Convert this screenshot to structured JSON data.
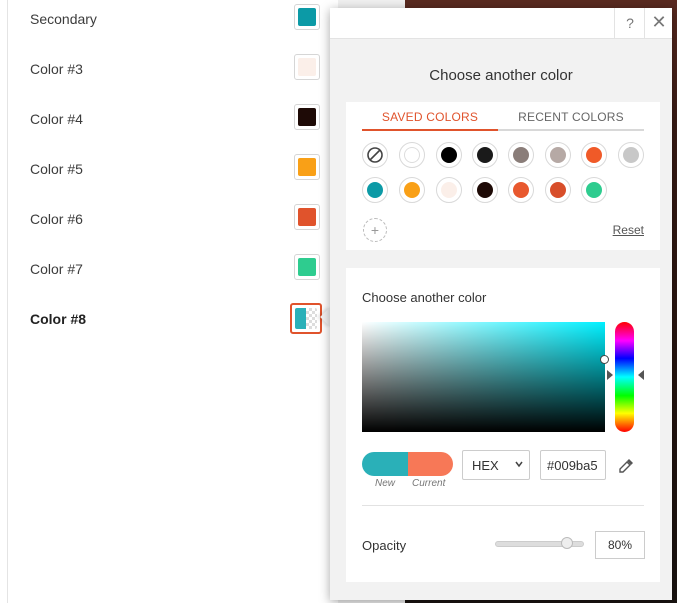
{
  "color_list": {
    "items": [
      {
        "label": "Secondary",
        "color": "#0c9aa6"
      },
      {
        "label": "Color #3",
        "color": "#fbefe9"
      },
      {
        "label": "Color #4",
        "color": "#1e0a06"
      },
      {
        "label": "Color #5",
        "color": "#f9a017"
      },
      {
        "label": "Color #6",
        "color": "#e0532c"
      },
      {
        "label": "Color #7",
        "color": "#2ecc8f"
      },
      {
        "label": "Color #8",
        "color": "#2ab0b8"
      }
    ]
  },
  "popup": {
    "title": "Choose another color",
    "help_label": "?",
    "close_label": "✕",
    "tabs": {
      "saved": "SAVED COLORS",
      "recent": "RECENT COLORS"
    },
    "saved_colors_row1": [
      "none",
      "#ffffff",
      "#000000",
      "#1a1a1a",
      "#8a7d79",
      "#b6a9a5",
      "#f05a28",
      "#c8c8c8"
    ],
    "saved_colors_row2": [
      "#0c9aa6",
      "#f9a017",
      "#fbefe9",
      "#1e0a06",
      "#e8582e",
      "#d84e2a",
      "#2ecc8f"
    ],
    "add_label": "+",
    "reset_label": "Reset",
    "picker": {
      "title": "Choose another color",
      "new_label": "New",
      "current_label": "Current",
      "new_color": "#2ab0b8",
      "current_color": "#f77857",
      "format": "HEX",
      "hex_value": "#009ba5",
      "opacity_label": "Opacity",
      "opacity_value": "80%"
    }
  }
}
